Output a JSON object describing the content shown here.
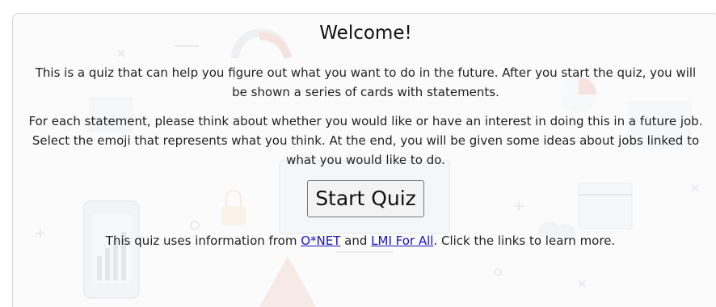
{
  "welcome": {
    "title": "Welcome!",
    "intro": "This is a quiz that can help you figure out what you want to do in the future. After you start the quiz, you will be shown a series of cards with statements.",
    "instructions": "For each statement, please think about whether you would like or have an interest in doing this in a future job. Select the emoji that represents what you think. At the end, you will be given some ideas about jobs linked to what you would like to do.",
    "start_button_label": "Start Quiz",
    "source_prefix": "This quiz uses information from ",
    "onet_link_label": "O*NET",
    "source_and": " and ",
    "lmi_link_label": "LMI For All",
    "source_suffix": ". Click the links to learn more."
  },
  "colors": {
    "link": "#1a12b8",
    "card_border": "#d4d4d4",
    "text": "#222222"
  }
}
